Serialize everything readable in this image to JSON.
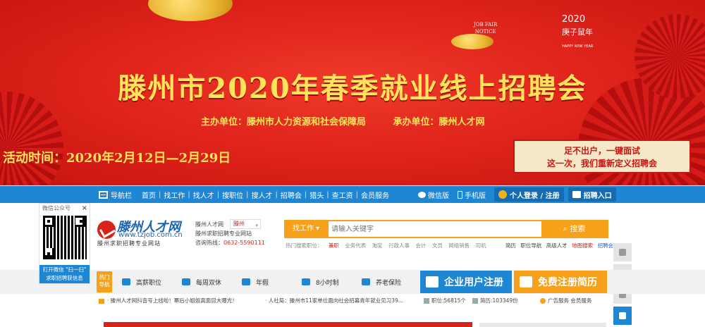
{
  "banner": {
    "title": "滕州市2020年春季就业线上招聘会",
    "organizer": "主办单位：滕州市人力资源和社会保障局",
    "undertaker": "承办单位：滕州人才网",
    "event_time": "活动时间：2020年2月12日—2月29日",
    "jobfair_line1": "JOB FAIR",
    "jobfair_line2": "NOTICE",
    "year": "2020",
    "zodiac": "庚子鼠年",
    "happy_new_year": "HAPPY NEW YEAR",
    "slogan_line1": "足不出户，一键面试",
    "slogan_line2": "这一次，我们重新定义招聘会",
    "colors": {
      "bg": "#e0251c",
      "gold": "#ffe35a"
    }
  },
  "nav": {
    "toggle_label": "导航栏",
    "links": [
      "首页",
      "找工作",
      "找人才",
      "搜职位",
      "搜人才",
      "招聘会",
      "猎头",
      "查工资",
      "会员服务"
    ],
    "wechat_label": "微信版",
    "mobile_label": "手机版",
    "login_label": "个人登录 / 注册",
    "recruit_label": "招聘入口"
  },
  "wechat_box": {
    "title": "微信公众号",
    "close": "×",
    "caption_line1": "打开微信 \"扫一扫\"",
    "caption_line2": "求职招聘获信息"
  },
  "logo": {
    "name": "滕州人才网",
    "url": "www.tzjob.com.cn",
    "tagline": "滕州求职招聘专业网站"
  },
  "site_info": {
    "name": "滕州人才网",
    "city": "滕州",
    "desc": "滕州求职招聘专业网站",
    "hotline": "咨询热线：",
    "phone": "0632-5590111"
  },
  "search": {
    "category": "找工作",
    "placeholder": "请输入关键字",
    "button": "搜索"
  },
  "hot_search": {
    "label": "热门搜索职位：",
    "items": [
      "兼职",
      "业务代表",
      "淘宝",
      "行政人事",
      "会计",
      "文员",
      "网络销售",
      "司机"
    ]
  },
  "quick_links": [
    "职位导航",
    "高级人才",
    "地图搜索",
    "招聘会"
  ],
  "quick_links_first": "简历",
  "categories": {
    "hot_tag": "热门导航",
    "items": [
      "高薪职位",
      "每周双休",
      "年假",
      "8小时制",
      "养老保险"
    ]
  },
  "cta": {
    "company": "企业用户注册",
    "resume": "免费注册简历"
  },
  "ticker": {
    "item1": "· 滕州人才网抖音号上线啦！幂后小姐姐真面目大曝光！",
    "item2": "· 人社局：滕州市11家单位面向社会招募青年就业见习39...",
    "jobs_label": "职位:56815个",
    "resumes_label": "简历:103349份",
    "service": "广告服务  会员服务"
  }
}
